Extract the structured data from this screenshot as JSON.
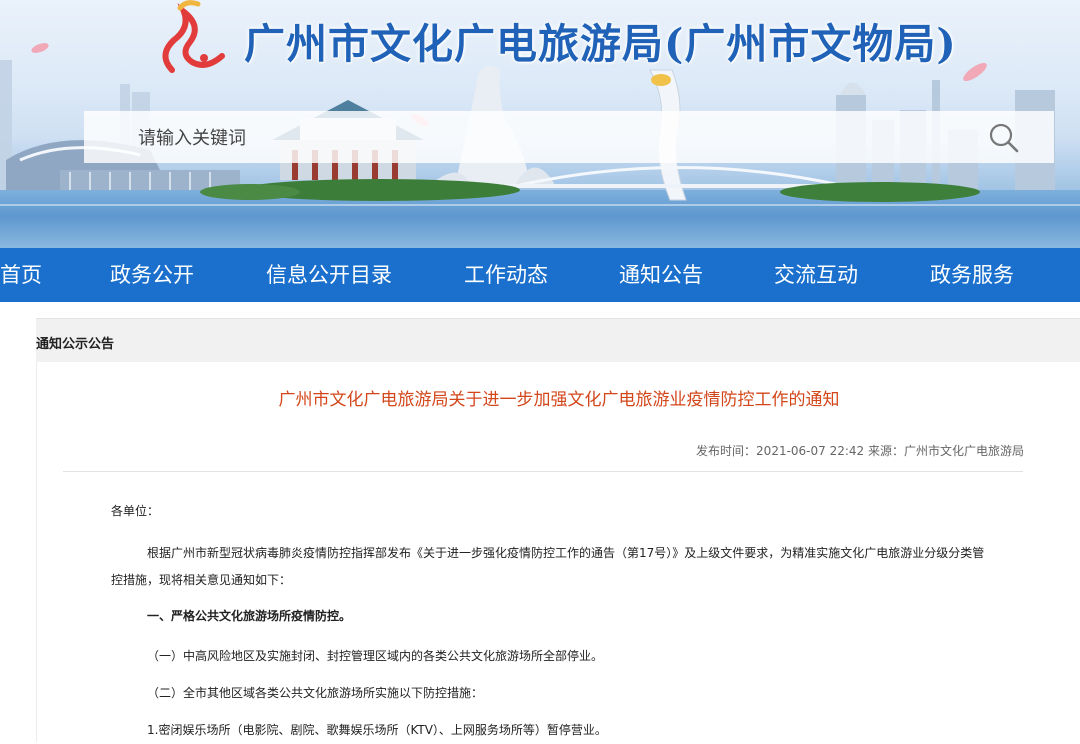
{
  "header": {
    "site_title": "广州市文化广电旅游局(广州市文物局)",
    "logo_icon": "guangzhou-culture-logo-icon",
    "title_color": "#1f62b7"
  },
  "search": {
    "placeholder": "请输入关键词",
    "button_icon": "search-icon"
  },
  "nav": {
    "items": [
      "首页",
      "政务公开",
      "信息公开目录",
      "工作动态",
      "通知公告",
      "交流互动",
      "政务服务"
    ],
    "bg_color": "#1a70cc"
  },
  "breadcrumb": "通知公示公告",
  "article": {
    "title": "广州市文化广电旅游局关于进一步加强文化广电旅游业疫情防控工作的通知",
    "title_color": "#d3461a",
    "meta": "发布时间：2021-06-07 22:42 来源：广州市文化广电旅游局",
    "salutation": "各单位：",
    "intro_line1": "根据广州市新型冠状病毒肺炎疫情防控指挥部发布《关于进一步强化疫情防控工作的通告（第17号）》及上级文件要求，为精准实施文化广电旅游业分级分类管",
    "intro_line2": "控措施，现将相关意见通知如下：",
    "section1_heading": "一、严格公共文化旅游场所疫情防控。",
    "item1": "（一）中高风险地区及实施封闭、封控管理区域内的各类公共文化旅游场所全部停业。",
    "item2": "（二）全市其他区域各类公共文化旅游场所实施以下防控措施：",
    "item2_1": "1.密闭娱乐场所（电影院、剧院、歌舞娱乐场所（KTV）、上网服务场所等）暂停营业。"
  }
}
